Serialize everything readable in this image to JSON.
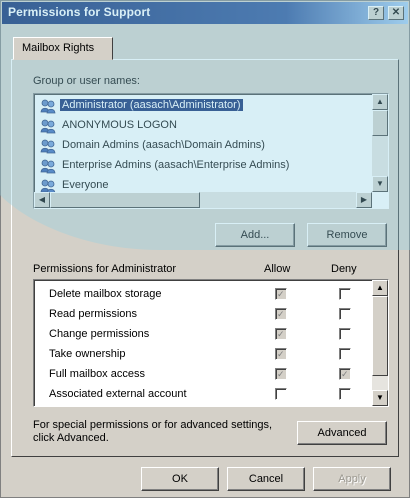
{
  "window": {
    "title": "Permissions for Support",
    "help_glyph": "?",
    "close_glyph": "✕"
  },
  "tab": {
    "label": "Mailbox Rights"
  },
  "group_label": "Group or user names:",
  "users": [
    {
      "name": "Administrator (aasach\\Administrator)",
      "selected": true
    },
    {
      "name": "ANONYMOUS LOGON",
      "selected": false
    },
    {
      "name": "Domain Admins (aasach\\Domain Admins)",
      "selected": false
    },
    {
      "name": "Enterprise Admins (aasach\\Enterprise Admins)",
      "selected": false
    },
    {
      "name": "Everyone",
      "selected": false
    }
  ],
  "buttons": {
    "add": "Add...",
    "remove": "Remove",
    "advanced": "Advanced",
    "ok": "OK",
    "cancel": "Cancel",
    "apply": "Apply"
  },
  "permissions_header": {
    "label": "Permissions for Administrator",
    "allow": "Allow",
    "deny": "Deny"
  },
  "permissions": [
    {
      "name": "Delete mailbox storage",
      "allow": "gray-checked",
      "deny": "unchecked"
    },
    {
      "name": "Read permissions",
      "allow": "gray-checked",
      "deny": "unchecked"
    },
    {
      "name": "Change permissions",
      "allow": "gray-checked",
      "deny": "unchecked"
    },
    {
      "name": "Take ownership",
      "allow": "gray-checked",
      "deny": "unchecked"
    },
    {
      "name": "Full mailbox access",
      "allow": "gray-checked",
      "deny": "gray-checked"
    },
    {
      "name": "Associated external account",
      "allow": "unchecked",
      "deny": "unchecked"
    }
  ],
  "advanced_note": "For special permissions or for advanced settings, click Advanced.",
  "icons": {
    "user_group": "user-group-icon",
    "scroll_up": "▲",
    "scroll_down": "▼",
    "scroll_left": "◀",
    "scroll_right": "▶",
    "check": "✓"
  },
  "colors": {
    "title_bar": "#0a246a",
    "selection": "#0a246a",
    "face": "#d4d0c8",
    "overlay": "#8fd0e4"
  }
}
